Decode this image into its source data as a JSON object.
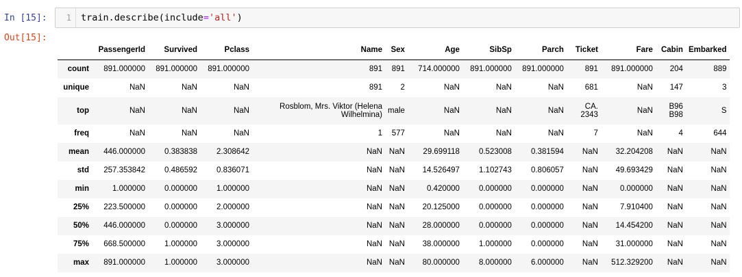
{
  "cell": {
    "in_prompt": "In [15]:",
    "out_prompt": "Out[15]:",
    "line_number": "1",
    "code": {
      "part1": "train.describe(include",
      "op": "=",
      "str": "'all'",
      "part2": ")"
    }
  },
  "table": {
    "columns": [
      "",
      "PassengerId",
      "Survived",
      "Pclass",
      "Name",
      "Sex",
      "Age",
      "SibSp",
      "Parch",
      "Ticket",
      "Fare",
      "Cabin",
      "Embarked"
    ],
    "rows": [
      [
        "count",
        "891.000000",
        "891.000000",
        "891.000000",
        "891",
        "891",
        "714.000000",
        "891.000000",
        "891.000000",
        "891",
        "891.000000",
        "204",
        "889"
      ],
      [
        "unique",
        "NaN",
        "NaN",
        "NaN",
        "891",
        "2",
        "NaN",
        "NaN",
        "NaN",
        "681",
        "NaN",
        "147",
        "3"
      ],
      [
        "top",
        "NaN",
        "NaN",
        "NaN",
        "Rosblom, Mrs. Viktor (Helena Wilhelmina)",
        "male",
        "NaN",
        "NaN",
        "NaN",
        "CA. 2343",
        "NaN",
        "B96 B98",
        "S"
      ],
      [
        "freq",
        "NaN",
        "NaN",
        "NaN",
        "1",
        "577",
        "NaN",
        "NaN",
        "NaN",
        "7",
        "NaN",
        "4",
        "644"
      ],
      [
        "mean",
        "446.000000",
        "0.383838",
        "2.308642",
        "NaN",
        "NaN",
        "29.699118",
        "0.523008",
        "0.381594",
        "NaN",
        "32.204208",
        "NaN",
        "NaN"
      ],
      [
        "std",
        "257.353842",
        "0.486592",
        "0.836071",
        "NaN",
        "NaN",
        "14.526497",
        "1.102743",
        "0.806057",
        "NaN",
        "49.693429",
        "NaN",
        "NaN"
      ],
      [
        "min",
        "1.000000",
        "0.000000",
        "1.000000",
        "NaN",
        "NaN",
        "0.420000",
        "0.000000",
        "0.000000",
        "NaN",
        "0.000000",
        "NaN",
        "NaN"
      ],
      [
        "25%",
        "223.500000",
        "0.000000",
        "2.000000",
        "NaN",
        "NaN",
        "20.125000",
        "0.000000",
        "0.000000",
        "NaN",
        "7.910400",
        "NaN",
        "NaN"
      ],
      [
        "50%",
        "446.000000",
        "0.000000",
        "3.000000",
        "NaN",
        "NaN",
        "28.000000",
        "0.000000",
        "0.000000",
        "NaN",
        "14.454200",
        "NaN",
        "NaN"
      ],
      [
        "75%",
        "668.500000",
        "1.000000",
        "3.000000",
        "NaN",
        "NaN",
        "38.000000",
        "1.000000",
        "0.000000",
        "NaN",
        "31.000000",
        "NaN",
        "NaN"
      ],
      [
        "max",
        "891.000000",
        "1.000000",
        "3.000000",
        "NaN",
        "NaN",
        "80.000000",
        "8.000000",
        "6.000000",
        "NaN",
        "512.329200",
        "NaN",
        "NaN"
      ]
    ]
  }
}
